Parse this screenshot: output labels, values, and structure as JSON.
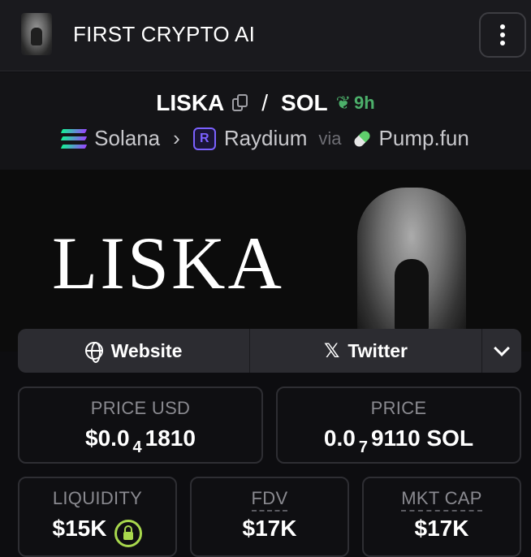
{
  "header": {
    "brand": "FIRST CRYPTO AI"
  },
  "pair": {
    "base": "LISKA",
    "quote": "SOL",
    "separator": "/",
    "age": "9h",
    "chain": "Solana",
    "dex": "Raydium",
    "via_label": "via",
    "launchpad": "Pump.fun"
  },
  "banner": {
    "title": "LISKA"
  },
  "links": {
    "website_label": "Website",
    "twitter_label": "Twitter"
  },
  "stats": {
    "price_usd": {
      "label": "PRICE USD",
      "prefix": "$0.0",
      "zeros": "4",
      "suffix": "1810"
    },
    "price_native": {
      "label": "PRICE",
      "prefix": "0.0",
      "zeros": "7",
      "suffix": "9110 SOL"
    },
    "liquidity": {
      "label": "LIQUIDITY",
      "value": "$15K"
    },
    "fdv": {
      "label": "FDV",
      "value": "$17K"
    },
    "mkt_cap": {
      "label": "MKT CAP",
      "value": "$17K"
    }
  },
  "colors": {
    "accent_green": "#4caf6a",
    "lock_green": "#a8d84d",
    "raydium_purple": "#7b61ff"
  },
  "icons": [
    "token-logo-icon",
    "kebab-menu-icon",
    "copy-icon",
    "sprout-icon",
    "solana-icon",
    "chevron-right-icon",
    "raydium-icon",
    "pill-icon",
    "globe-icon",
    "x-logo-icon",
    "chevron-down-icon",
    "lock-icon"
  ]
}
